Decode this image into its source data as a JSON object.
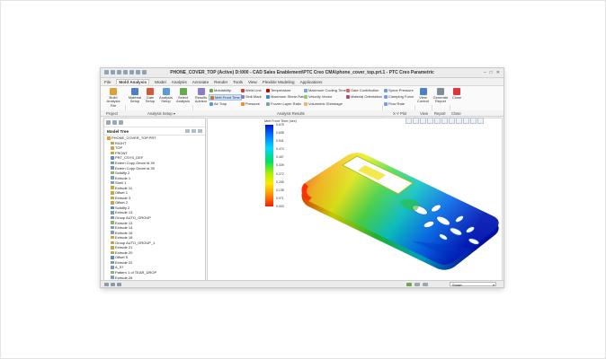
{
  "window": {
    "title": "PHONE_COVER_TOP (Active) D:\\000 - CAD Sales Enablement\\PTC Creo CMA\\phone_cover_top.prt.1 - PTC Creo Parametric",
    "controls": [
      "–",
      "□",
      "✕"
    ]
  },
  "menu": {
    "tabs": [
      {
        "label": "File",
        "active": false
      },
      {
        "label": "Mold Analysis",
        "active": true
      },
      {
        "label": "Model",
        "active": false
      },
      {
        "label": "Analysis",
        "active": false
      },
      {
        "label": "Annotate",
        "active": false
      },
      {
        "label": "Render",
        "active": false
      },
      {
        "label": "Tools",
        "active": false
      },
      {
        "label": "View",
        "active": false
      },
      {
        "label": "Flexible Modeling",
        "active": false
      },
      {
        "label": "Applications",
        "active": false
      }
    ]
  },
  "ribbon": {
    "buttons": [
      {
        "label": "Build Analysis File",
        "icon": "build-icon",
        "color": "#d9a23a"
      },
      {
        "label": "Material Setup",
        "icon": "material-icon",
        "color": "#4d7fc2"
      },
      {
        "label": "Gate Setup",
        "icon": "gate-icon",
        "color": "#d05a3a"
      },
      {
        "label": "Analysis Setup",
        "icon": "analysis-setup-icon",
        "color": "#5b9bd5"
      },
      {
        "label": "Select Analysis",
        "icon": "select-analysis-icon",
        "color": "#6aa84f"
      },
      {
        "label": "Results Advisor",
        "icon": "results-advisor-icon",
        "color": "#8e7cc3"
      }
    ],
    "results_col1": [
      "Moldability",
      "Melt Front Time",
      "Air Trap"
    ],
    "results_col2": [
      "Weld Line",
      "Sink Mark",
      "Pressure"
    ],
    "results_col3": [
      "Temperature",
      "Maximum Shear Rate",
      "Frozen Layer Ratio"
    ],
    "results_col4": [
      "Maximum Cooling Time",
      "Velocity Vector",
      "Volumetric Shrinkage"
    ],
    "results_col5": [
      "Gate Contribution",
      "Material Orientation"
    ],
    "xy_plot": [
      "Sprue Pressure",
      "Clamping Force",
      "Flow Rate"
    ],
    "view_buttons": [
      {
        "label": "View Control",
        "icon": "view-control-icon",
        "color": "#4d7fc2"
      },
      {
        "label": "Generate Report",
        "icon": "report-icon",
        "color": "#7f8c99"
      },
      {
        "label": "Close",
        "icon": "close-icon",
        "color": "#d9363e"
      }
    ],
    "groups": [
      "Project",
      "Analysis Setup ▾",
      "Analysis Results",
      "X-Y Plot",
      "View",
      "Report",
      "Close"
    ]
  },
  "tree": {
    "header": "Model Tree",
    "items": [
      "PHONE_COVER_TOP.PRT",
      "RIGHT",
      "TOP",
      "FRONT",
      "PRT_CSYS_DEF",
      "Extern Copy Geom id 39",
      "Extern Copy Geom id 39",
      "Solidify 2",
      "Extrude 1",
      "Shell 1",
      "Extrude 11",
      "Offset 1",
      "Extrude 3",
      "Offset 2",
      "Solidify 2",
      "Extrude 13",
      "Group AUTO_GROUP",
      "Extrude 13",
      "Extrude 14",
      "Extrude 16",
      "Extrude 18",
      "Group AUTO_GROUP_1",
      "Extrude 21",
      "Extrude 20",
      "Offset 5",
      "Extrude 22",
      "A_57",
      "Pattern 1 of TEAR_DROP",
      "Extrude 28",
      "Pattern 2 of Round 1"
    ]
  },
  "legend": {
    "title": "Melt Front Time (sec)",
    "values": [
      "0.675",
      "0.608",
      "0.541",
      "0.474",
      "0.407",
      "0.339",
      "0.272",
      "0.205",
      "0.138",
      "0.071",
      "0.003"
    ]
  },
  "status": {
    "filter": "Smart"
  }
}
